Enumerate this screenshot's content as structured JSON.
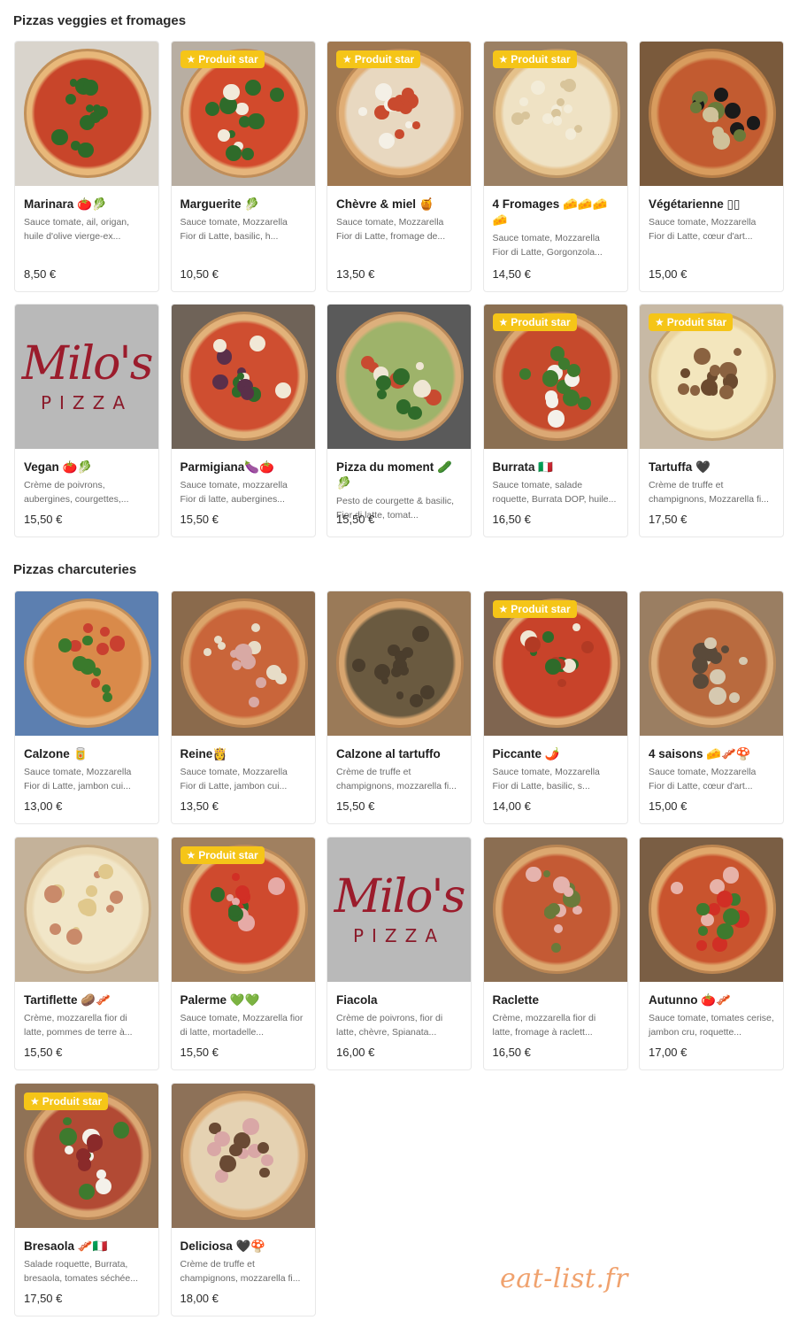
{
  "sections": [
    {
      "title": "Pizzas veggies et fromages",
      "items": [
        {
          "name": "Marinara 🍅🥬",
          "desc": "Sauce tomate, ail, origan, huile d'olive vierge-ex...",
          "price": "8,50 €",
          "badge": "",
          "image": "pizza-marinara"
        },
        {
          "name": "Marguerite 🥬",
          "desc": "Sauce tomate, Mozzarella Fior di Latte, basilic, h...",
          "price": "10,50 €",
          "badge": "Produit star",
          "image": "pizza-marguerite"
        },
        {
          "name": "Chèvre & miel 🍯",
          "desc": "Sauce tomate, Mozzarella Fior di Latte, fromage de...",
          "price": "13,50 €",
          "badge": "Produit star",
          "image": "pizza-chevre-miel"
        },
        {
          "name": "4 Fromages 🧀🧀🧀 🧀",
          "desc": "Sauce tomate, Mozzarella Fior di Latte, Gorgonzola...",
          "price": "14,50 €",
          "badge": "Produit star",
          "image": "pizza-4-fromages"
        },
        {
          "name": "Végétarienne ▯▯",
          "desc": "Sauce tomate, Mozzarella Fior di Latte, cœur d'art...",
          "price": "15,00 €",
          "badge": "",
          "image": "pizza-vegetarienne"
        },
        {
          "name": "Vegan 🍅🥬",
          "desc": "Crème de poivrons, aubergines, courgettes,...",
          "price": "15,50 €",
          "badge": "",
          "image": "milos-pizza-logo"
        },
        {
          "name": "Parmigiana🍆🍅",
          "desc": "Sauce tomate, mozzarella Fior di latte, aubergines...",
          "price": "15,50 €",
          "badge": "",
          "image": "pizza-parmigiana"
        },
        {
          "name": "Pizza du moment 🥒🥬",
          "desc": "Pesto de courgette & basilic, Fior di latte, tomat...",
          "price": "15,50 €",
          "badge": "",
          "image": "pizza-du-moment"
        },
        {
          "name": "Burrata 🇮🇹",
          "desc": "Sauce tomate, salade roquette, Burrata DOP, huile...",
          "price": "16,50 €",
          "badge": "Produit star",
          "image": "pizza-burrata"
        },
        {
          "name": "Tartuffa 🖤",
          "desc": "Crème de truffe et champignons, Mozzarella fi...",
          "price": "17,50 €",
          "badge": "Produit star",
          "image": "pizza-tartuffa"
        }
      ]
    },
    {
      "title": "Pizzas charcuteries",
      "items": [
        {
          "name": "Calzone 🥫",
          "desc": "Sauce tomate, Mozzarella Fior di Latte, jambon cui...",
          "price": "13,00 €",
          "badge": "",
          "image": "pizza-calzone"
        },
        {
          "name": "Reine👸",
          "desc": "Sauce tomate, Mozzarella Fior di Latte, jambon cui...",
          "price": "13,50 €",
          "badge": "",
          "image": "pizza-reine"
        },
        {
          "name": "Calzone al tartuffo",
          "desc": "Crème de truffe et champignons, mozzarella fi...",
          "price": "15,50 €",
          "badge": "",
          "image": "pizza-calzone-tartuffo"
        },
        {
          "name": "Piccante 🌶️",
          "desc": "Sauce tomate, Mozzarella Fior di Latte, basilic, s...",
          "price": "14,00 €",
          "badge": "Produit star",
          "image": "pizza-piccante"
        },
        {
          "name": "4 saisons 🧀🥓🍄",
          "desc": "Sauce tomate, Mozzarella Fior di Latte, cœur d'art...",
          "price": "15,00 €",
          "badge": "",
          "image": "pizza-4-saisons"
        },
        {
          "name": "Tartiflette 🥔🥓",
          "desc": "Crème, mozzarella fior di latte, pommes de terre à...",
          "price": "15,50 €",
          "badge": "",
          "image": "pizza-tartiflette"
        },
        {
          "name": "Palerme 💚💚",
          "desc": "Sauce tomate, Mozzarella fior di latte, mortadelle...",
          "price": "15,50 €",
          "badge": "Produit star",
          "image": "pizza-palerme"
        },
        {
          "name": "Fiacola",
          "desc": "Crème de poivrons, fior di latte, chèvre, Spianata...",
          "price": "16,00 €",
          "badge": "",
          "image": "milos-pizza-logo"
        },
        {
          "name": "Raclette",
          "desc": "Crème, mozzarella fior di latte, fromage à raclett...",
          "price": "16,50 €",
          "badge": "",
          "image": "pizza-raclette"
        },
        {
          "name": "Autunno 🍅🥓",
          "desc": "Sauce tomate, tomates cerise, jambon cru, roquette...",
          "price": "17,00 €",
          "badge": "",
          "image": "pizza-autunno"
        },
        {
          "name": "Bresaola 🥓🇮🇹",
          "desc": "Salade roquette, Burrata, bresaola, tomates séchée...",
          "price": "17,50 €",
          "badge": "Produit star",
          "image": "pizza-bresaola"
        },
        {
          "name": "Deliciosa 🖤🍄",
          "desc": "Crème de truffe et champignons, mozzarella fi...",
          "price": "18,00 €",
          "badge": "",
          "image": "pizza-deliciosa"
        }
      ]
    }
  ],
  "logo": {
    "script": "Milo's",
    "word": "PIZZA"
  },
  "watermark": "eat-list.fr",
  "colors": {
    "badge": "#f5c518",
    "logo": "#9b1c2c",
    "watermark": "#f0a26e"
  }
}
